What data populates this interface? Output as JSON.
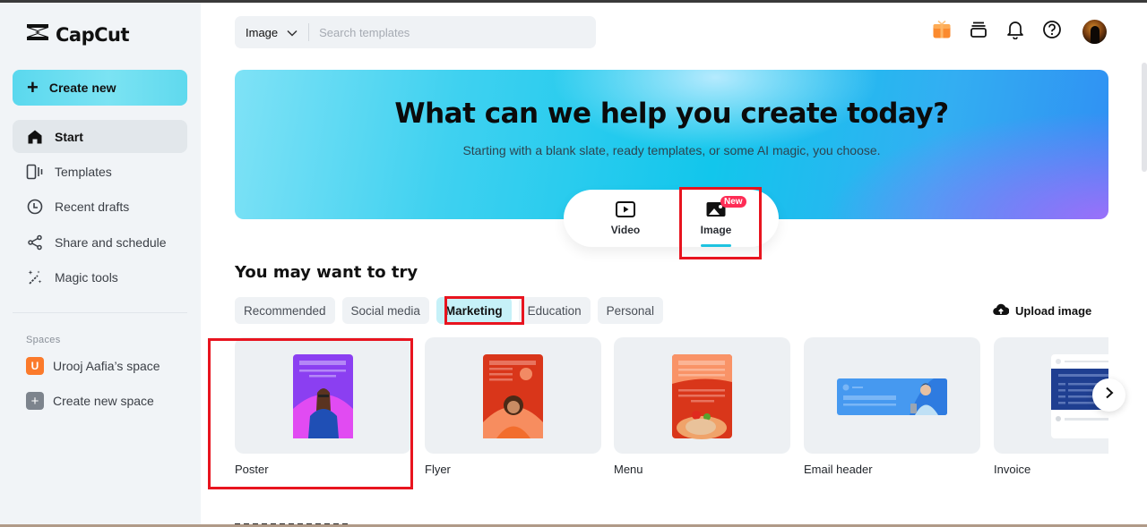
{
  "app": {
    "name": "CapCut"
  },
  "sidebar": {
    "create_label": "Create new",
    "nav": [
      {
        "label": "Start",
        "icon": "home-icon",
        "active": true
      },
      {
        "label": "Templates",
        "icon": "templates-icon",
        "active": false
      },
      {
        "label": "Recent drafts",
        "icon": "clock-icon",
        "active": false
      },
      {
        "label": "Share and schedule",
        "icon": "share-icon",
        "active": false
      },
      {
        "label": "Magic tools",
        "icon": "magic-wand-icon",
        "active": false
      }
    ],
    "spaces_label": "Spaces",
    "spaces": [
      {
        "label": "Urooj Aafia’s space",
        "badge": "U",
        "color": "#fb7a2b"
      },
      {
        "label": "Create new space",
        "badge": "+",
        "color": "#7d848d"
      }
    ]
  },
  "header": {
    "search_type": "Image",
    "search_placeholder": "Search templates",
    "icons": [
      "gift-icon",
      "inbox-stack-icon",
      "bell-icon",
      "help-icon",
      "avatar"
    ]
  },
  "hero": {
    "title": "What can we help you create today?",
    "subtitle": "Starting with a blank slate, ready templates, or some AI magic, you choose.",
    "modes": [
      {
        "label": "Video",
        "icon": "video-icon",
        "selected": false
      },
      {
        "label": "Image",
        "icon": "image-icon",
        "selected": true,
        "badge": "New"
      }
    ]
  },
  "try_section": {
    "title": "You may want to try",
    "chips": [
      {
        "label": "Recommended",
        "active": false
      },
      {
        "label": "Social media",
        "active": false
      },
      {
        "label": "Marketing",
        "active": true
      },
      {
        "label": "Education",
        "active": false
      },
      {
        "label": "Personal",
        "active": false
      }
    ],
    "upload_label": "Upload image",
    "cards": [
      {
        "label": "Poster"
      },
      {
        "label": "Flyer"
      },
      {
        "label": "Menu"
      },
      {
        "label": "Email header"
      },
      {
        "label": "Invoice"
      }
    ]
  },
  "colors": {
    "accent_cyan": "#1ec3e0",
    "highlight_red": "#e8141f",
    "new_badge": "#fe2c55",
    "sidebar_bg": "#f1f4f7"
  }
}
